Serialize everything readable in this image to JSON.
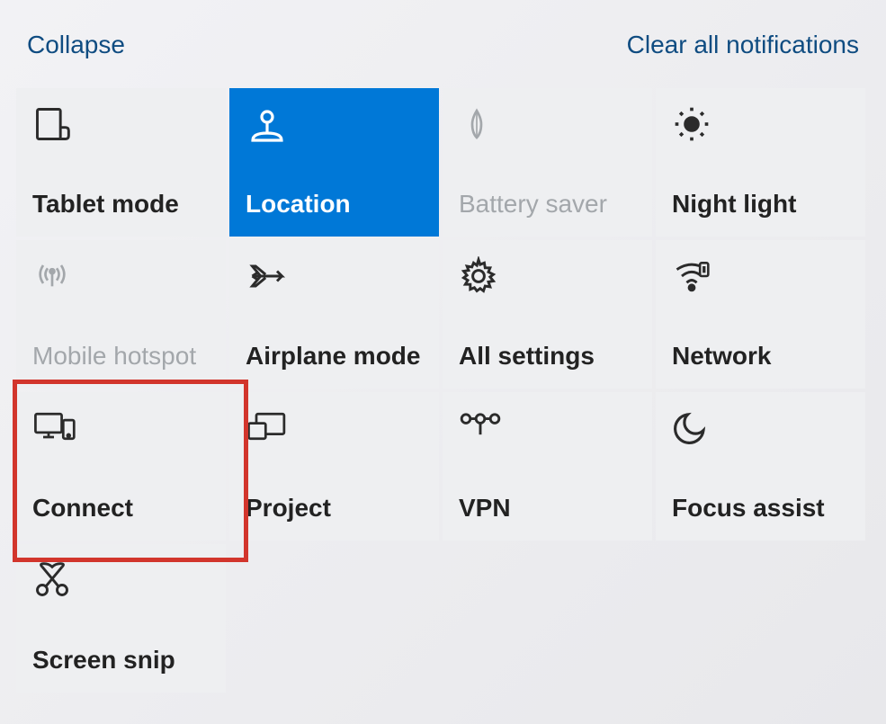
{
  "header": {
    "collapse": "Collapse",
    "clear": "Clear all notifications"
  },
  "tiles": {
    "tablet_mode": "Tablet mode",
    "location": "Location",
    "battery_saver": "Battery saver",
    "night_light": "Night light",
    "mobile_hotspot": "Mobile hotspot",
    "airplane_mode": "Airplane mode",
    "all_settings": "All settings",
    "network": "Network",
    "connect": "Connect",
    "project": "Project",
    "vpn": "VPN",
    "focus_assist": "Focus assist",
    "screen_snip": "Screen snip"
  }
}
